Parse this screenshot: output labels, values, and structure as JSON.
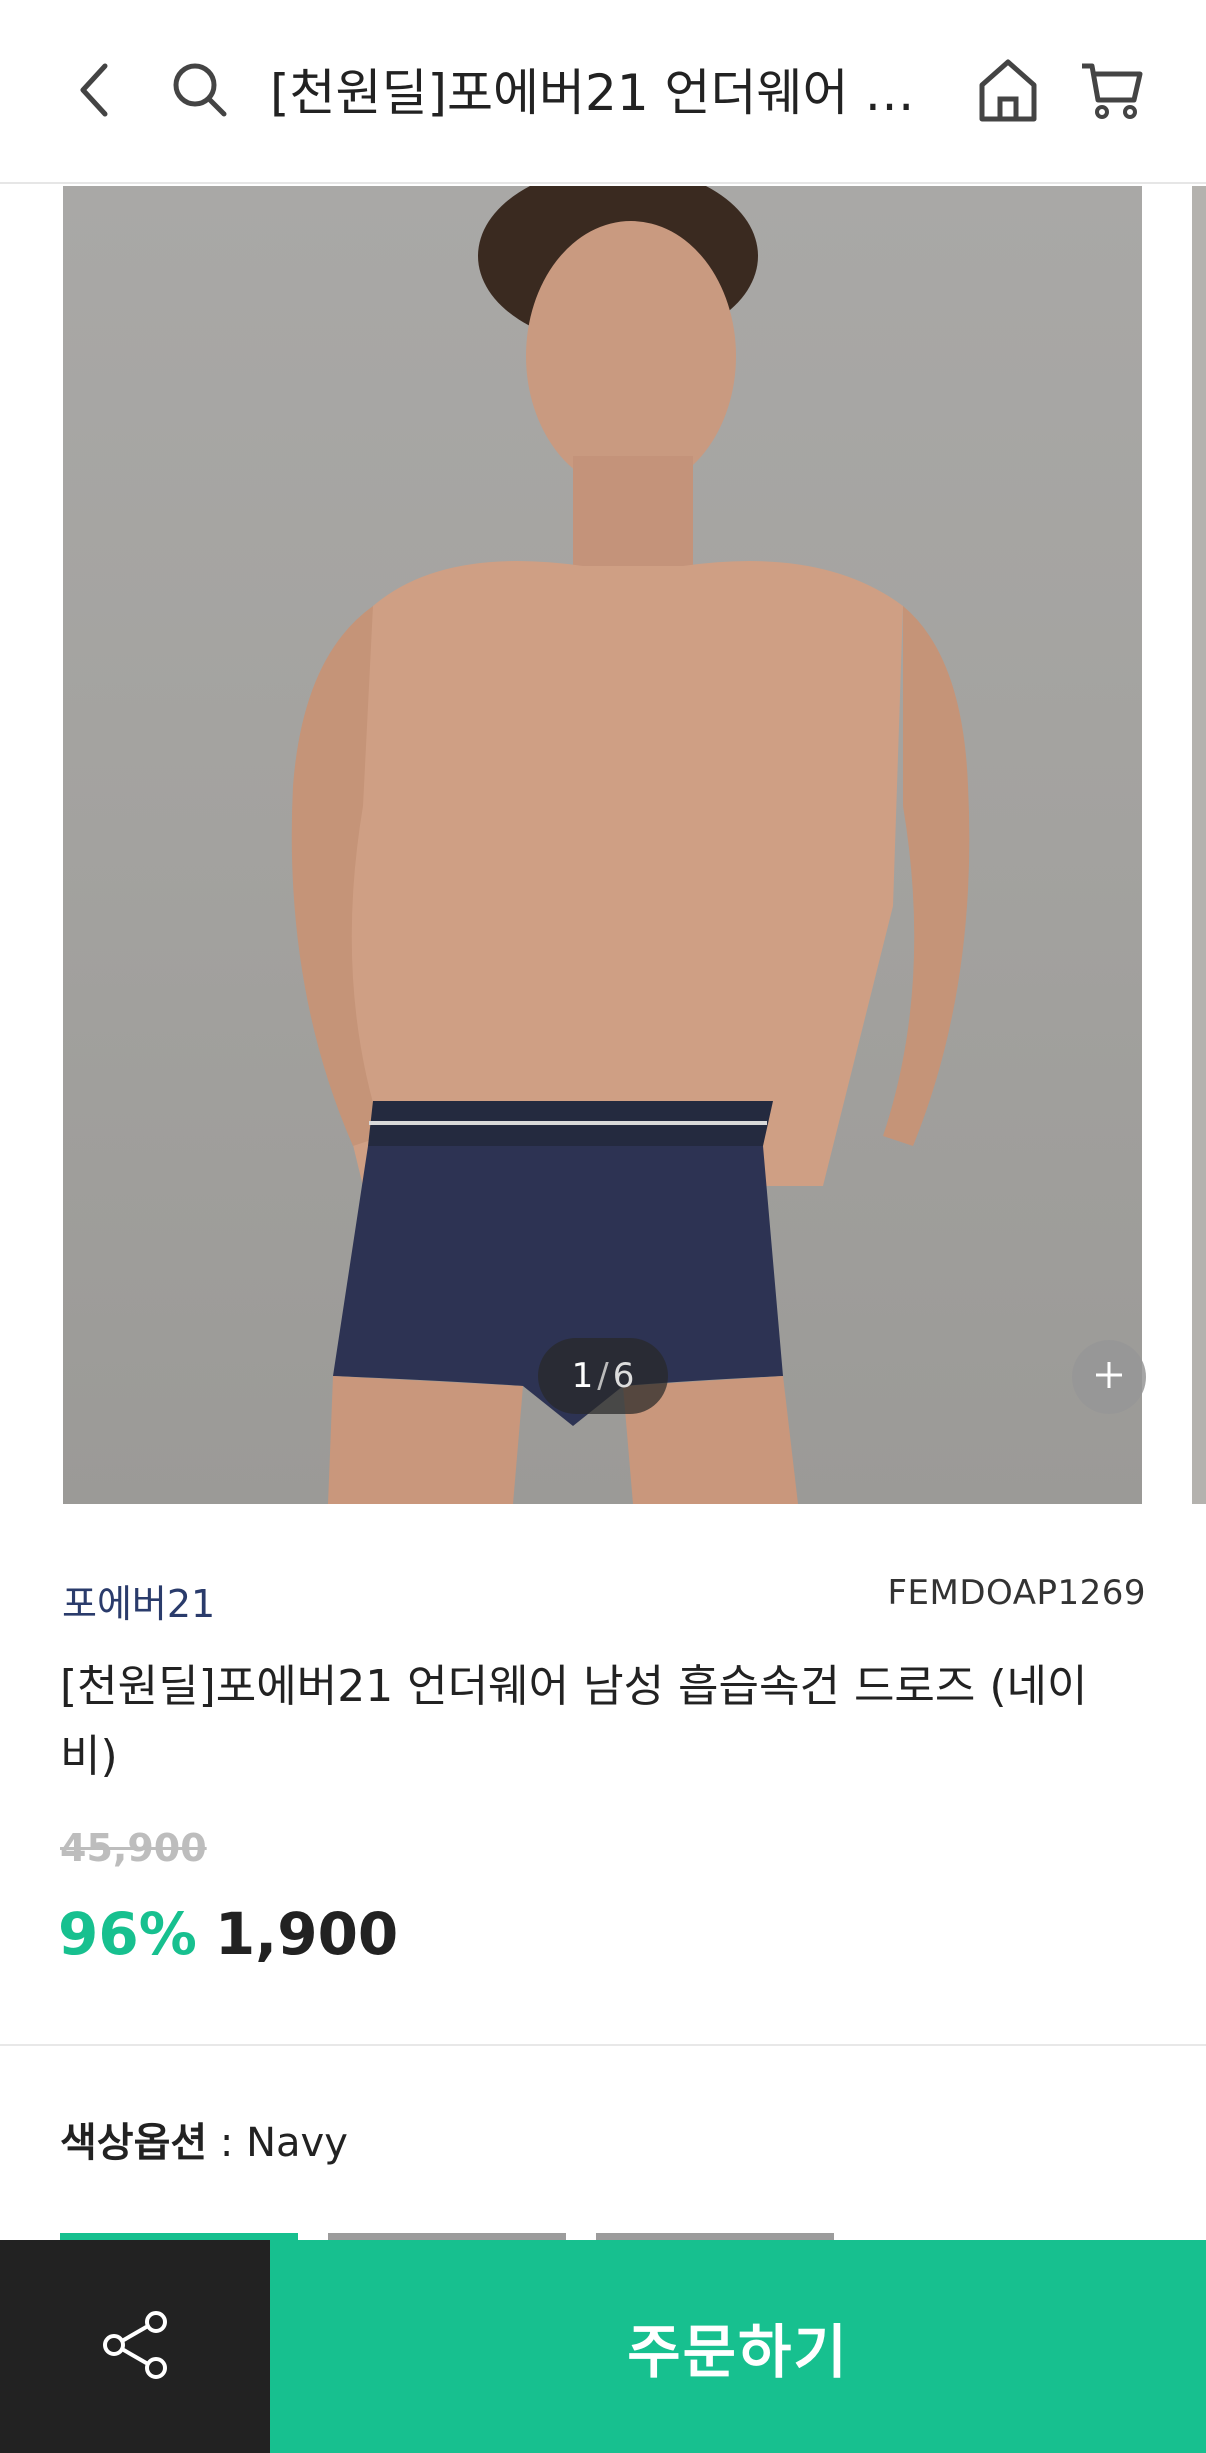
{
  "header": {
    "title": "[천원딜]포에버21 언더웨어 남성 흡습속건 드로즈 (네이비)",
    "icons": {
      "back": "back-arrow-icon",
      "search": "search-icon",
      "home": "home-icon",
      "cart": "cart-icon"
    }
  },
  "gallery": {
    "current": "1",
    "separator": "/",
    "total": "6",
    "zoom_icon": "plus-icon"
  },
  "product": {
    "brand": "포에버21",
    "sku": "FEMDOAP1269",
    "title": "[천원딜]포에버21 언더웨어 남성 흡습속건 드로즈 (네이비)",
    "original_price": "45,900",
    "discount": "96%",
    "price": "1,900"
  },
  "options": {
    "label_key": "색상옵션",
    "label_sep": " : ",
    "selected_value": "Navy",
    "swatch_count": 3
  },
  "bottom_bar": {
    "share_icon": "share-icon",
    "order_label": "주문하기"
  },
  "colors": {
    "accent": "#17c08f",
    "brand": "#2a3b6b",
    "dark_bar": "#222222"
  }
}
